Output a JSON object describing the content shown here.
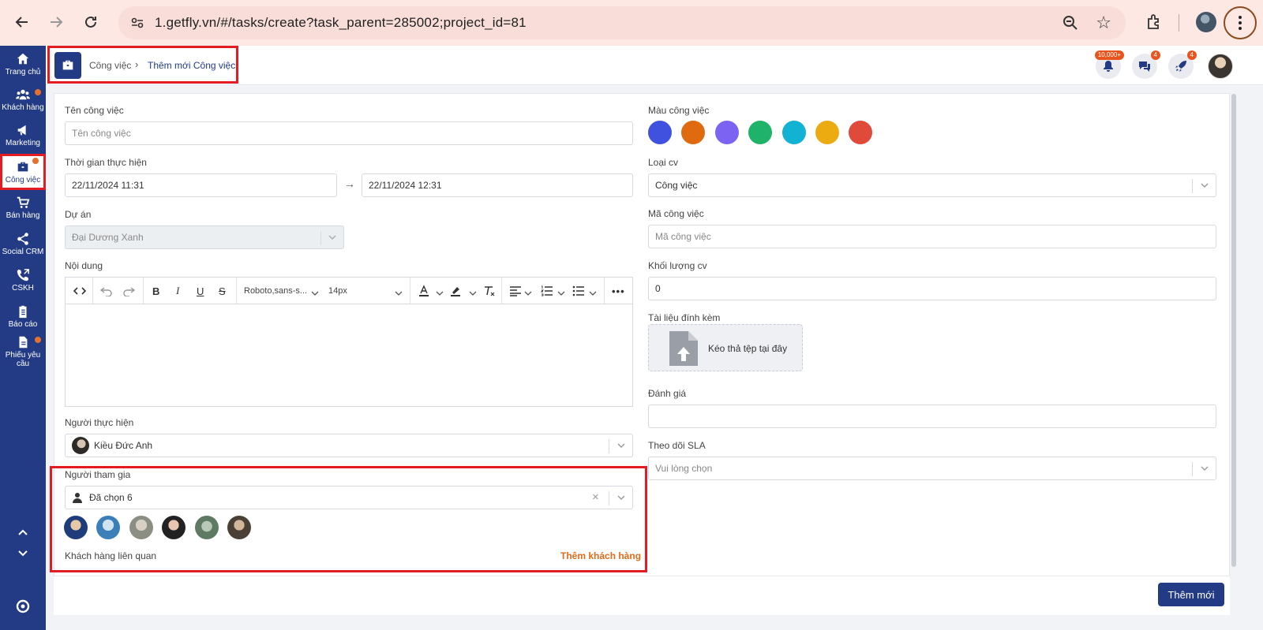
{
  "browser": {
    "url": "1.getfly.vn/#/tasks/create?task_parent=285002;project_id=81"
  },
  "sidebar": {
    "items": [
      {
        "label": "Trang chủ",
        "icon": "home-icon"
      },
      {
        "label": "Khách hàng",
        "icon": "users-icon"
      },
      {
        "label": "Marketing",
        "icon": "megaphone-icon"
      },
      {
        "label": "Công việc",
        "icon": "briefcase-icon"
      },
      {
        "label": "Bán hàng",
        "icon": "cart-icon"
      },
      {
        "label": "Social CRM",
        "icon": "share-icon"
      },
      {
        "label": "CSKH",
        "icon": "phone-icon"
      },
      {
        "label": "Báo cáo",
        "icon": "clipboard-icon"
      },
      {
        "label": "Phiếu yêu cầu",
        "icon": "document-icon"
      }
    ]
  },
  "header": {
    "breadcrumb_parent": "Công việc",
    "breadcrumb_current": "Thêm mới Công việc",
    "notif_badge": "10,000+",
    "chat_badge": "4",
    "rocket_badge": "4"
  },
  "form": {
    "task_name_label": "Tên công việc",
    "task_name_placeholder": "Tên công việc",
    "time_label": "Thời gian thực hiện",
    "start_time": "22/11/2024 11:31",
    "end_time": "22/11/2024 12:31",
    "project_label": "Dự án",
    "project_value": "Đại Dương Xanh",
    "content_label": "Nội dung",
    "editor": {
      "font_family": "Roboto,sans-s...",
      "font_size": "14px"
    },
    "assignee_label": "Người thực hiện",
    "assignee_value": "Kiều Đức Anh",
    "participants_label": "Người tham gia",
    "participants_value": "Đã chọn 6",
    "related_customers_label": "Khách hàng liên quan",
    "add_customer_link": "Thêm khách hàng",
    "color_label": "Màu công việc",
    "colors": [
      "#4051e0",
      "#e06b0e",
      "#7c63f2",
      "#1fb36a",
      "#12b2d4",
      "#edab12",
      "#e04a3a"
    ],
    "type_label": "Loại cv",
    "type_value": "Công việc",
    "code_label": "Mã công việc",
    "code_placeholder": "Mã công việc",
    "volume_label": "Khối lượng cv",
    "volume_value": "0",
    "attachment_label": "Tài liệu đính kèm",
    "attachment_drop_text": "Kéo thả tệp tại đây",
    "rating_label": "Đánh giá",
    "sla_label": "Theo dõi SLA",
    "sla_placeholder": "Vui lòng chọn",
    "submit_label": "Thêm mới"
  }
}
